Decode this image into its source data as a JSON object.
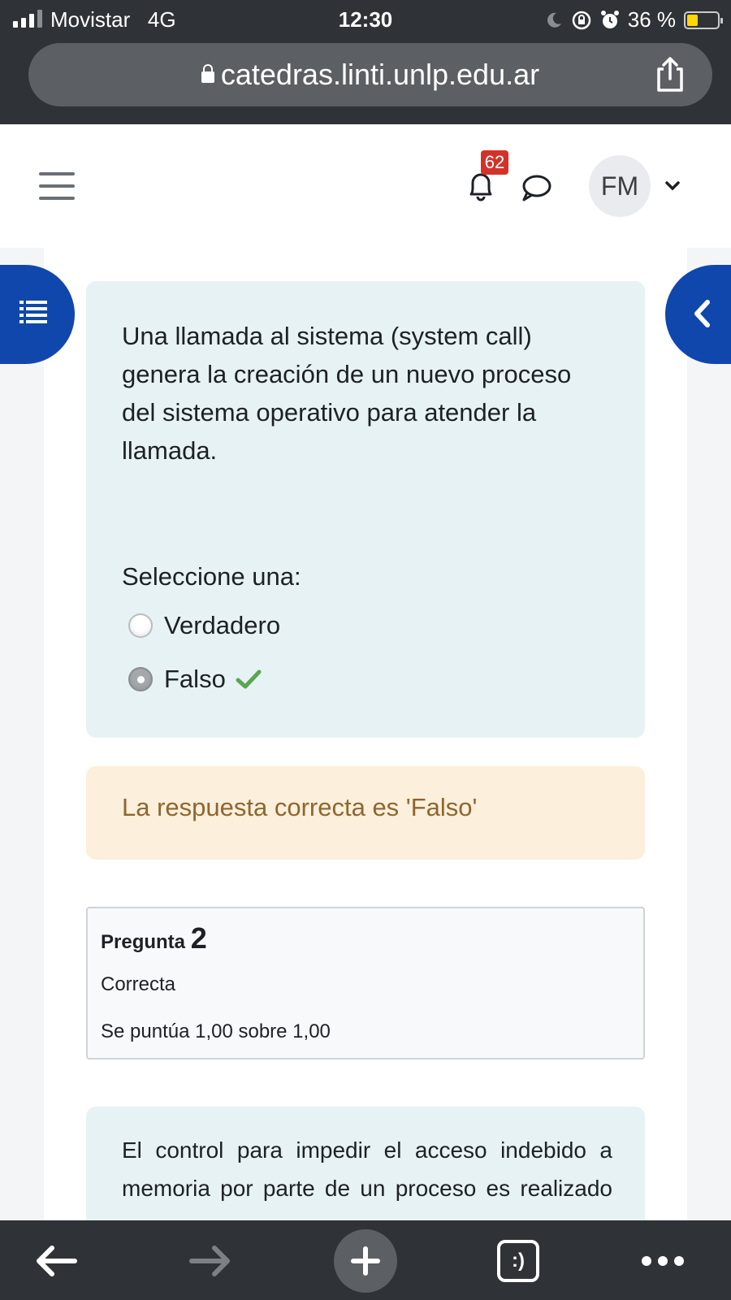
{
  "status_bar": {
    "carrier": "Movistar",
    "network": "4G",
    "time": "12:30",
    "battery": "36 %",
    "battery_level": 0.36,
    "icons": [
      "signal-icon",
      "moon-icon",
      "rotation-lock-icon",
      "alarm-icon",
      "battery-icon"
    ]
  },
  "browser": {
    "url": "catedras.linti.unlp.edu.ar",
    "icons": [
      "lock-icon",
      "share-icon"
    ]
  },
  "header": {
    "notification_count": "62",
    "avatar_initials": "FM",
    "icons": [
      "hamburger-menu-icon",
      "bell-icon",
      "chat-icon",
      "chevron-down-icon"
    ]
  },
  "question1": {
    "text": "Una llamada al sistema (system call) genera la creación de un nuevo proceso del sistema operativo para atender la llamada.",
    "prompt": "Seleccione una:",
    "options": [
      {
        "label": "Verdadero",
        "selected": false
      },
      {
        "label": "Falso",
        "selected": true,
        "correct": true
      }
    ],
    "feedback": "La respuesta correcta es 'Falso'"
  },
  "question2_info": {
    "label": "Pregunta",
    "number": "2",
    "state": "Correcta",
    "grade": "Se puntúa 1,00 sobre 1,00"
  },
  "question2": {
    "text": "El control para impedir el acceso indebido a memoria por parte de un proceso es realizado"
  },
  "colors": {
    "accent": "#0f47ad",
    "question_bg": "#e7f2f4",
    "feedback_bg": "#fcefdc",
    "feedback_text": "#8e662e",
    "badge": "#d3322b",
    "check": "#5aa650"
  },
  "toolbar": {
    "tabs_label": ":)",
    "icons": [
      "back-arrow-icon",
      "forward-arrow-icon",
      "plus-icon",
      "tabs-icon",
      "more-icon"
    ]
  }
}
